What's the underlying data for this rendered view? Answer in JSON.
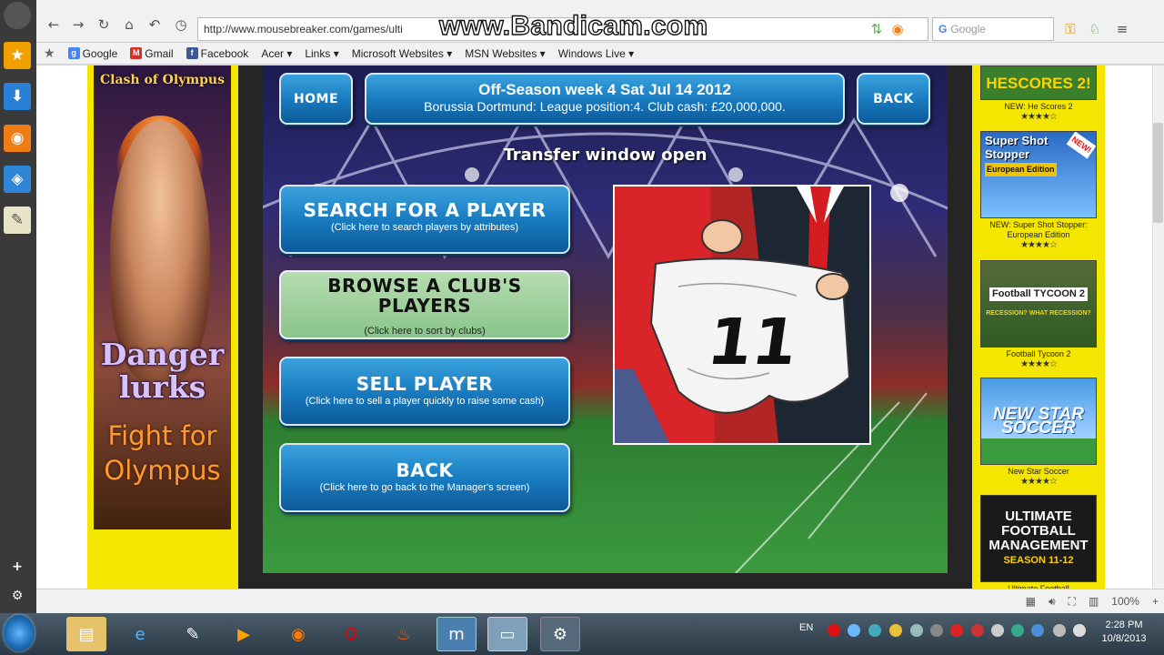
{
  "browser": {
    "url": "http://www.mousebreaker.com/games/ulti",
    "search_placeholder": "Google",
    "watermark": "www.Bandicam.com",
    "zoom": "100%"
  },
  "bookmarks": [
    {
      "label": "Google",
      "icon": "google-icon",
      "color": "#4285f4"
    },
    {
      "label": "Gmail",
      "icon": "gmail-icon",
      "color": "#d93025"
    },
    {
      "label": "Facebook",
      "icon": "facebook-icon",
      "color": "#3b5998"
    },
    {
      "label": "Acer ▾"
    },
    {
      "label": "Links ▾"
    },
    {
      "label": "Microsoft Websites ▾"
    },
    {
      "label": "MSN Websites ▾"
    },
    {
      "label": "Windows Live ▾"
    }
  ],
  "ad": {
    "logo": "Clash of Olympus",
    "line1": "Danger lurks",
    "line2": "Fight for Olympus"
  },
  "game": {
    "home_label": "HOME",
    "back_top_label": "BACK",
    "header_line1": "Off-Season week 4 Sat Jul 14 2012",
    "header_line2": "Borussia Dortmund: League position:4. Club cash: £20,000,000.",
    "transfer_title": "Transfer window open",
    "menu": {
      "search_title": "SEARCH FOR A PLAYER",
      "search_sub": "(Click here to search players by attributes)",
      "browse_title": "BROWSE A CLUB'S PLAYERS",
      "browse_sub": "(Click here to sort by clubs)",
      "sell_title": "SELL PLAYER",
      "sell_sub": "(Click here to sell a player quickly to raise some cash)",
      "back_title": "BACK",
      "back_sub": "(Click here to go back to the Manager's screen)"
    },
    "shirt_number": "11"
  },
  "sidebar_games": [
    {
      "thumb_text": "HESCORES 2!",
      "caption": "NEW: He Scores 2",
      "stars": "★★★★☆",
      "bg": "#3a7f2c"
    },
    {
      "thumb_text": "Super Shot Stopper",
      "thumb_sub": "European Edition",
      "badge": "NEW!",
      "caption": "NEW: Super Shot Stopper: European Edition",
      "stars": "★★★★☆",
      "bg": "#1c5fb5"
    },
    {
      "thumb_text": "Football TYCOON 2",
      "thumb_sub": "RECESSION? WHAT RECESSION?",
      "caption": "Football Tycoon 2",
      "stars": "★★★★☆",
      "bg": "#4f7a2a"
    },
    {
      "thumb_text": "NEW STAR SOCCER",
      "caption": "New Star Soccer",
      "stars": "★★★★☆",
      "bg": "#3d86d6"
    },
    {
      "thumb_text": "ULTIMATE FOOTBALL MANAGEMENT",
      "thumb_sub": "SEASON 11-12",
      "caption": "Ultimate Football",
      "stars": "",
      "bg": "#1a1a1a"
    }
  ],
  "taskbar": {
    "lang": "EN",
    "time": "2:28 PM",
    "date": "10/8/2013"
  }
}
